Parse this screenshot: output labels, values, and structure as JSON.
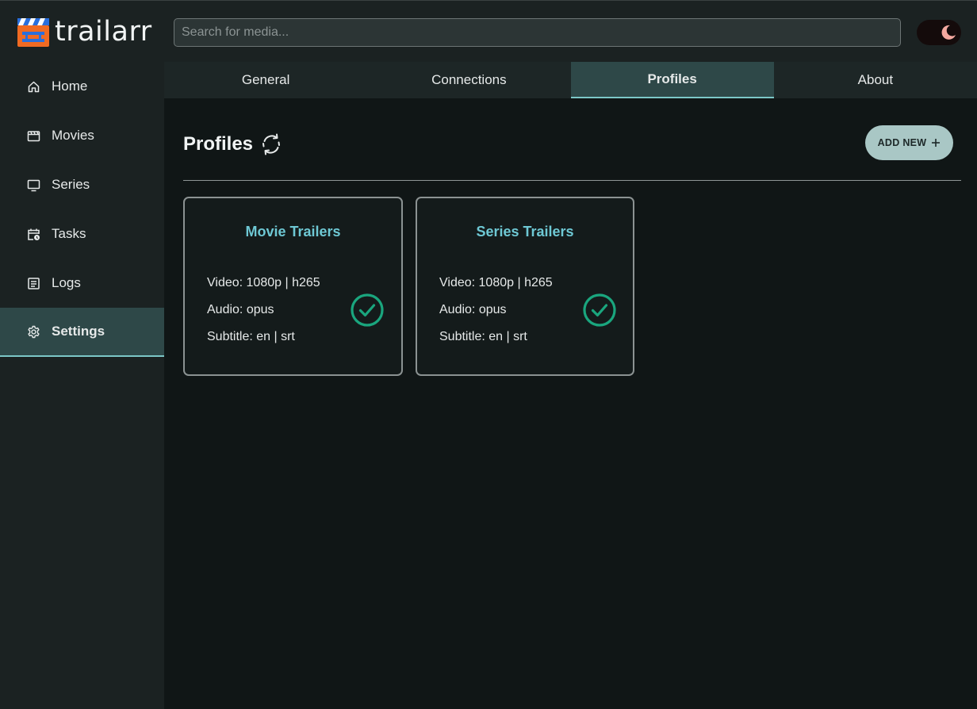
{
  "app": {
    "name": "trailarr",
    "accent_color": "#7cc7c7",
    "active_bg": "#2e4848"
  },
  "search": {
    "placeholder": "Search for media...",
    "value": ""
  },
  "theme_toggle": {
    "mode": "dark",
    "icon": "moon-icon"
  },
  "sidebar": {
    "items": [
      {
        "label": "Home",
        "icon": "home-icon",
        "active": false
      },
      {
        "label": "Movies",
        "icon": "film-icon",
        "active": false
      },
      {
        "label": "Series",
        "icon": "tv-icon",
        "active": false
      },
      {
        "label": "Tasks",
        "icon": "calendar-clock-icon",
        "active": false
      },
      {
        "label": "Logs",
        "icon": "log-icon",
        "active": false
      },
      {
        "label": "Settings",
        "icon": "gear-icon",
        "active": true
      }
    ]
  },
  "tabs": [
    {
      "label": "General",
      "active": false
    },
    {
      "label": "Connections",
      "active": false
    },
    {
      "label": "Profiles",
      "active": true
    },
    {
      "label": "About",
      "active": false
    }
  ],
  "main": {
    "title": "Profiles",
    "refresh_icon": "refresh-icon",
    "add_button": "ADD NEW"
  },
  "profiles": [
    {
      "name": "Movie Trailers",
      "video": "Video: 1080p | h265",
      "audio": "Audio: opus",
      "subtitle": "Subtitle: en | srt",
      "enabled": true
    },
    {
      "name": "Series Trailers",
      "video": "Video: 1080p | h265",
      "audio": "Audio: opus",
      "subtitle": "Subtitle: en | srt",
      "enabled": true
    }
  ],
  "colors": {
    "profile_title": "#6ec8d4",
    "check": "#1aa67e",
    "add_button_bg": "#a9c7c5"
  }
}
